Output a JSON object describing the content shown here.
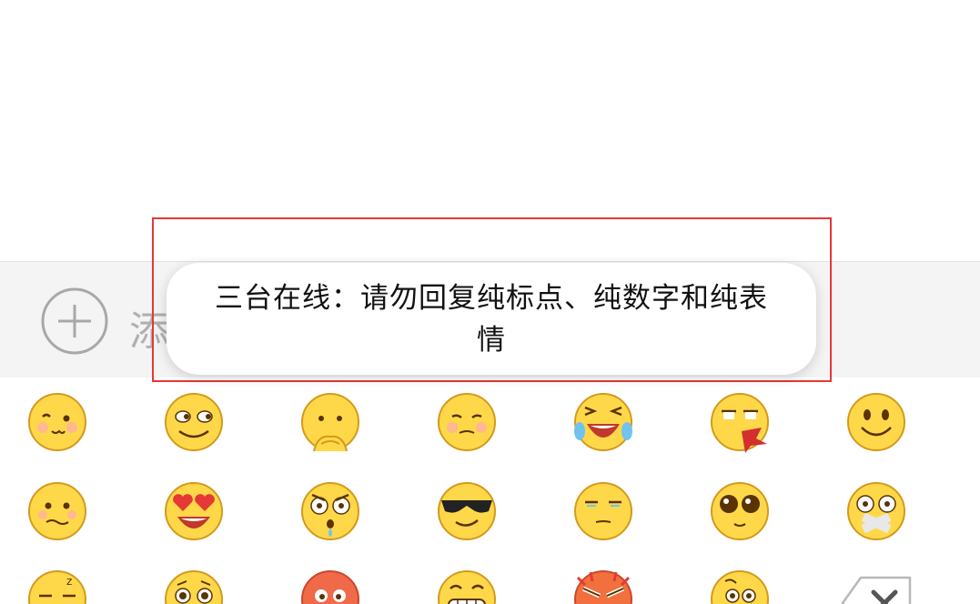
{
  "toolbar": {
    "add_label": "添加图文"
  },
  "toast": {
    "message": "三台在线：请勿回复纯标点、纯数字和纯表情"
  },
  "emoji_rows": [
    [
      "shy-face-icon",
      "squint-face-icon",
      "thinking-face-icon",
      "embarrassed-face-icon",
      "laugh-crying-face-icon",
      "nosebleed-face-icon",
      "smile-face-icon"
    ],
    [
      "worried-face-icon",
      "heart-eyes-face-icon",
      "shocked-face-icon",
      "sunglasses-face-icon",
      "smug-face-icon",
      "sparkle-eyes-face-icon",
      "taped-mouth-face-icon"
    ],
    [
      "sleepy-face-icon",
      "nervous-face-icon",
      "angry-red-face-icon",
      "grin-face-icon",
      "furious-face-icon",
      "pondering-face-icon",
      "backspace-icon"
    ]
  ],
  "colors": {
    "toast_border": "#e53935",
    "emoji_yellow": "#ffd84a",
    "emoji_outline": "#d39a1c",
    "toolbar_bg": "#f4f4f4"
  }
}
